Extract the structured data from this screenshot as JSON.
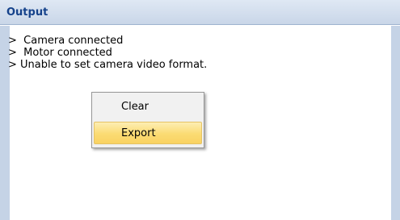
{
  "panel": {
    "title": "Output"
  },
  "log": {
    "lines": [
      ">  Camera connected",
      ">  Motor connected",
      "> Unable to set camera video format."
    ]
  },
  "context_menu": {
    "items": [
      {
        "label": "Clear",
        "highlighted": false
      },
      {
        "label": "Export",
        "highlighted": true
      }
    ]
  },
  "colors": {
    "header_text": "#15428b",
    "header_bg": "#c9d6e8",
    "frame": "#c5d3e6",
    "highlight": "#fbdb73"
  }
}
